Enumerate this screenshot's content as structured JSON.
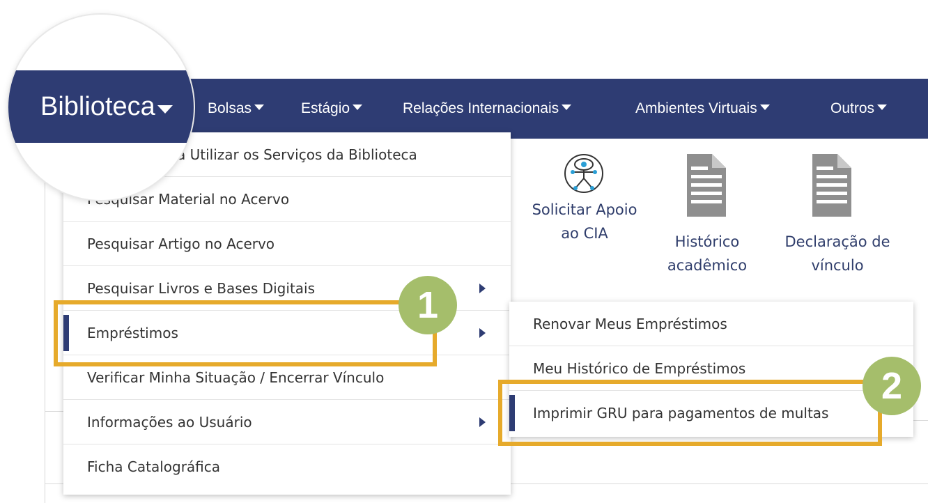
{
  "navbar": {
    "items": [
      {
        "label": "Biblioteca"
      },
      {
        "label": "Bolsas"
      },
      {
        "label": "Estágio"
      },
      {
        "label": "Relações Internacionais"
      },
      {
        "label": "Ambientes Virtuais"
      },
      {
        "label": "Outros"
      }
    ]
  },
  "quick_access": [
    {
      "label_line1": "Solicitar Apoio",
      "label_line2": "ao CIA",
      "icon": "accessibility-icon"
    },
    {
      "label_line1": "Histórico",
      "label_line2": "acadêmico",
      "icon": "document-icon"
    },
    {
      "label_line1": "Declaração de",
      "label_line2": "vínculo",
      "icon": "document-icon"
    }
  ],
  "library_menu": {
    "items": [
      {
        "label": "Cadastro para Utilizar os Serviços da Biblioteca"
      },
      {
        "label": "Pesquisar Material no Acervo"
      },
      {
        "label": "Pesquisar Artigo no Acervo"
      },
      {
        "label": "Pesquisar Livros e Bases Digitais"
      },
      {
        "label": "Empréstimos"
      },
      {
        "label": "Verificar Minha Situação / Encerrar Vínculo"
      },
      {
        "label": "Informações ao Usuário"
      },
      {
        "label": "Ficha Catalográfica"
      }
    ]
  },
  "loans_submenu": {
    "items": [
      {
        "label": "Renovar Meus Empréstimos"
      },
      {
        "label": "Meu Histórico de Empréstimos"
      },
      {
        "label": "Imprimir GRU para pagamentos de multas"
      }
    ]
  },
  "annotations": {
    "step1": "1",
    "step2": "2",
    "highlight_color": "#e6aa2b",
    "badge_color": "#a5be6b"
  },
  "colors": {
    "navbar": "#2e3c73",
    "accent": "#2e3c73"
  }
}
